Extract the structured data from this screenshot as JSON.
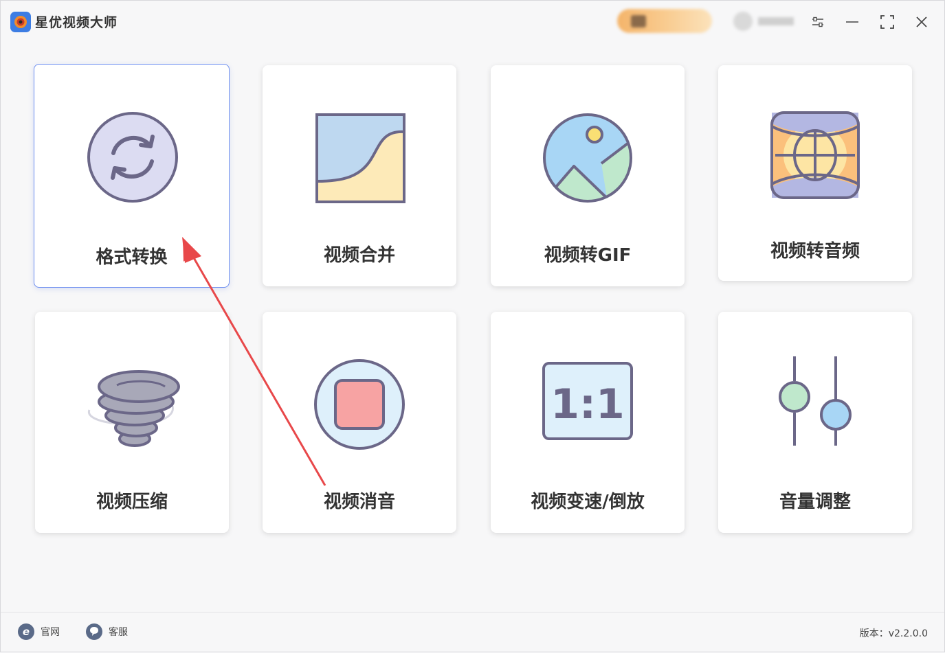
{
  "app": {
    "title": "星优视频大师",
    "version_label": "版本：v2.2.0.0"
  },
  "tools": [
    {
      "label": "格式转换",
      "icon": "refresh-icon"
    },
    {
      "label": "视频合并",
      "icon": "merge-icon"
    },
    {
      "label": "视频转GIF",
      "icon": "image-icon"
    },
    {
      "label": "视频转音频",
      "icon": "globe-audio-icon"
    },
    {
      "label": "视频压缩",
      "icon": "tornado-icon"
    },
    {
      "label": "视频消音",
      "icon": "stop-icon"
    },
    {
      "label": "视频变速/倒放",
      "icon": "ratio-icon"
    },
    {
      "label": "音量调整",
      "icon": "sliders-icon"
    }
  ],
  "icon_texts": {
    "ratio": "1:1"
  },
  "footer": {
    "website_label": "官网",
    "support_label": "客服"
  },
  "colors": {
    "accent": "#6e8ff0",
    "arrow": "#e8484a",
    "icon_stroke": "#6b6788"
  }
}
